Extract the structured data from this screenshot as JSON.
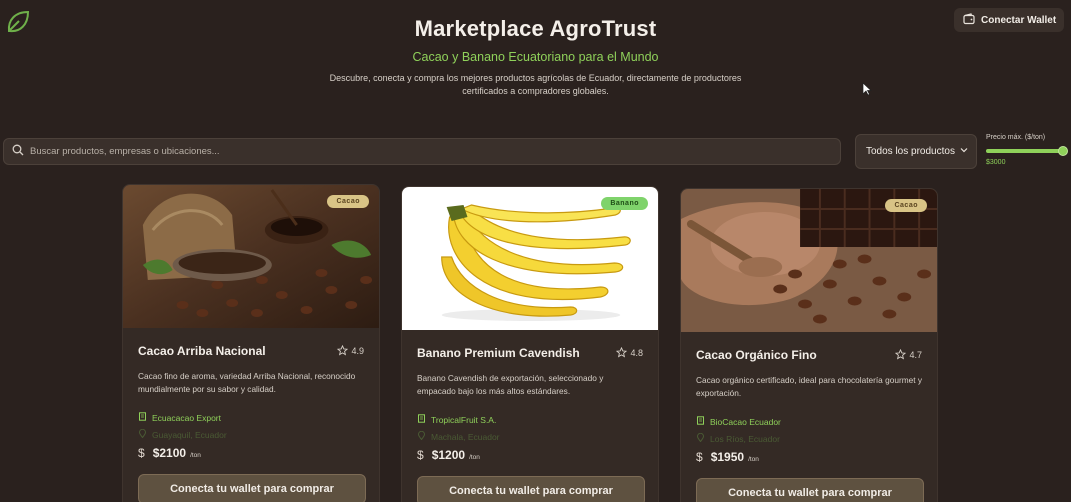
{
  "header": {
    "wallet_label": "Conectar Wallet",
    "title": "Marketplace AgroTrust",
    "subtitle": "Cacao y Banano Ecuatoriano para el Mundo",
    "description": "Descubre, conecta y compra los mejores productos agrícolas de Ecuador, directamente de productores certificados a compradores globales."
  },
  "filters": {
    "search_placeholder": "Buscar productos, empresas o ubicaciones...",
    "category_selected": "Todos los productos",
    "price_label": "Precio máx. ($/ton)",
    "price_value": "$3000",
    "price_fraction": 1.0
  },
  "products": [
    {
      "badge": "Cacao",
      "name": "Cacao Arriba Nacional",
      "rating": "4.9",
      "description": "Cacao fino de aroma, variedad Arriba Nacional, reconocido mundialmente por su sabor y calidad.",
      "company": "Ecuacacao Export",
      "location": "Guayaquil, Ecuador",
      "price": "$2100",
      "unit": "/ton",
      "button": "Conecta tu wallet para comprar"
    },
    {
      "badge": "Banano",
      "name": "Banano Premium Cavendish",
      "rating": "4.8",
      "description": "Banano Cavendish de exportación, seleccionado y empacado bajo los más altos estándares.",
      "company": "TropicalFruit S.A.",
      "location": "Machala, Ecuador",
      "price": "$1200",
      "unit": "/ton",
      "button": "Conecta tu wallet para comprar"
    },
    {
      "badge": "Cacao",
      "name": "Cacao Orgánico Fino",
      "rating": "4.7",
      "description": "Cacao orgánico certificado, ideal para chocolatería gourmet y exportación.",
      "company": "BioCacao Ecuador",
      "location": "Los Ríos, Ecuador",
      "price": "$1950",
      "unit": "/ton",
      "button": "Conecta tu wallet para comprar"
    }
  ],
  "icons": {
    "logo": "leaf-icon",
    "wallet": "wallet-icon",
    "search": "search-icon",
    "rating": "star-icon",
    "company": "building-icon",
    "location": "map-pin-icon",
    "price": "dollar-icon"
  },
  "colors": {
    "background": "#2a211e",
    "accent_green": "#8fd15a",
    "card": "#342a25",
    "cacao_badge": "#d9c486",
    "banano_badge": "#7fd36b"
  }
}
